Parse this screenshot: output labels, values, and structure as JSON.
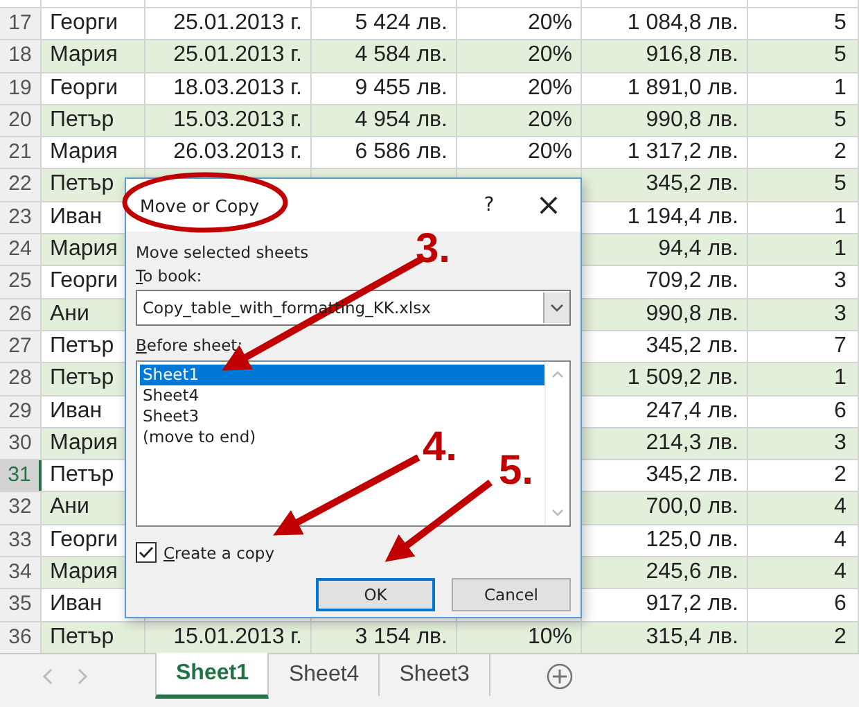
{
  "sheet": {
    "rows": [
      {
        "number": "17",
        "active": false,
        "shaded": false,
        "name": "Георги",
        "date": "25.01.2013 г.",
        "amount": "5 424 лв.",
        "percent": "20%",
        "result": "1 084,8 лв.",
        "column_7": "5"
      },
      {
        "number": "18",
        "active": false,
        "shaded": true,
        "name": "Мария",
        "date": "25.01.2013 г.",
        "amount": "4 584 лв.",
        "percent": "20%",
        "result": "916,8 лв.",
        "column_7": "5"
      },
      {
        "number": "19",
        "active": false,
        "shaded": false,
        "name": "Георги",
        "date": "18.03.2013 г.",
        "amount": "9 455 лв.",
        "percent": "20%",
        "result": "1 891,0 лв.",
        "column_7": "1"
      },
      {
        "number": "20",
        "active": false,
        "shaded": true,
        "name": "Петър",
        "date": "15.03.2013 г.",
        "amount": "4 954 лв.",
        "percent": "20%",
        "result": "990,8 лв.",
        "column_7": "5"
      },
      {
        "number": "21",
        "active": false,
        "shaded": false,
        "name": "Мария",
        "date": "26.03.2013 г.",
        "amount": "6 586 лв.",
        "percent": "20%",
        "result": "1 317,2 лв.",
        "column_7": "2"
      },
      {
        "number": "22",
        "active": false,
        "shaded": true,
        "name": "Петър",
        "result": "345,2 лв.",
        "column_7": "5"
      },
      {
        "number": "23",
        "active": false,
        "shaded": false,
        "name": "Иван",
        "result": "1 194,4 лв.",
        "column_7": "1"
      },
      {
        "number": "24",
        "active": false,
        "shaded": true,
        "name": "Мария",
        "result": "94,4 лв.",
        "column_7": "1"
      },
      {
        "number": "25",
        "active": false,
        "shaded": false,
        "name": "Георги",
        "result": "709,2 лв.",
        "column_7": "3"
      },
      {
        "number": "26",
        "active": false,
        "shaded": true,
        "name": "Ани",
        "result": "990,8 лв.",
        "column_7": "3"
      },
      {
        "number": "27",
        "active": false,
        "shaded": false,
        "name": "Петър",
        "result": "345,2 лв.",
        "column_7": "7"
      },
      {
        "number": "28",
        "active": false,
        "shaded": true,
        "name": "Петър",
        "result": "1 509,2 лв.",
        "column_7": "1"
      },
      {
        "number": "29",
        "active": false,
        "shaded": false,
        "name": "Иван",
        "result": "247,4 лв.",
        "column_7": "6"
      },
      {
        "number": "30",
        "active": false,
        "shaded": true,
        "name": "Мария",
        "result": "214,3 лв.",
        "column_7": "3"
      },
      {
        "number": "31",
        "active": true,
        "shaded": false,
        "name": "Петър",
        "result": "345,2 лв.",
        "column_7": "2"
      },
      {
        "number": "32",
        "active": false,
        "shaded": true,
        "name": "Ани",
        "result": "700,0 лв.",
        "column_7": "4"
      },
      {
        "number": "33",
        "active": false,
        "shaded": false,
        "name": "Георги",
        "result": "125,0 лв.",
        "column_7": "4"
      },
      {
        "number": "34",
        "active": false,
        "shaded": true,
        "name": "Мария",
        "result": "245,6 лв.",
        "column_7": "4"
      },
      {
        "number": "35",
        "active": false,
        "shaded": false,
        "name": "Иван",
        "result": "917,2 лв.",
        "column_7": "6"
      },
      {
        "number": "36",
        "active": false,
        "shaded": true,
        "name": "Петър",
        "date": "15.01.2013 г.",
        "amount": "3 154 лв.",
        "percent": "10%",
        "result": "315,4 лв.",
        "column_7": "2"
      }
    ]
  },
  "dialog": {
    "title": "Move or Copy",
    "help": "?",
    "close": "×",
    "caption": "Move selected sheets",
    "to_book_label": {
      "text": "To book:",
      "underline_first": true
    },
    "book": "Copy_table_with_formatting_KK.xlsx",
    "before_sheet_label": {
      "text": "Before sheet:",
      "underline_first": true
    },
    "sheets": [
      {
        "label": "Sheet1",
        "selected": true
      },
      {
        "label": "Sheet4",
        "selected": false
      },
      {
        "label": "Sheet3",
        "selected": false
      },
      {
        "label": "(move to end)",
        "selected": false
      }
    ],
    "create_copy": {
      "label": "Create a copy",
      "checked": true,
      "underline_first": true
    },
    "buttons": [
      {
        "label": "OK",
        "default": true
      },
      {
        "label": "Cancel",
        "default": false
      }
    ]
  },
  "annotations": {
    "steps": [
      "3.",
      "4.",
      "5."
    ]
  },
  "sheet_tabs": [
    {
      "label": "Sheet1",
      "selected": true
    },
    {
      "label": "Sheet4",
      "selected": false
    },
    {
      "label": "Sheet3",
      "selected": false
    }
  ]
}
